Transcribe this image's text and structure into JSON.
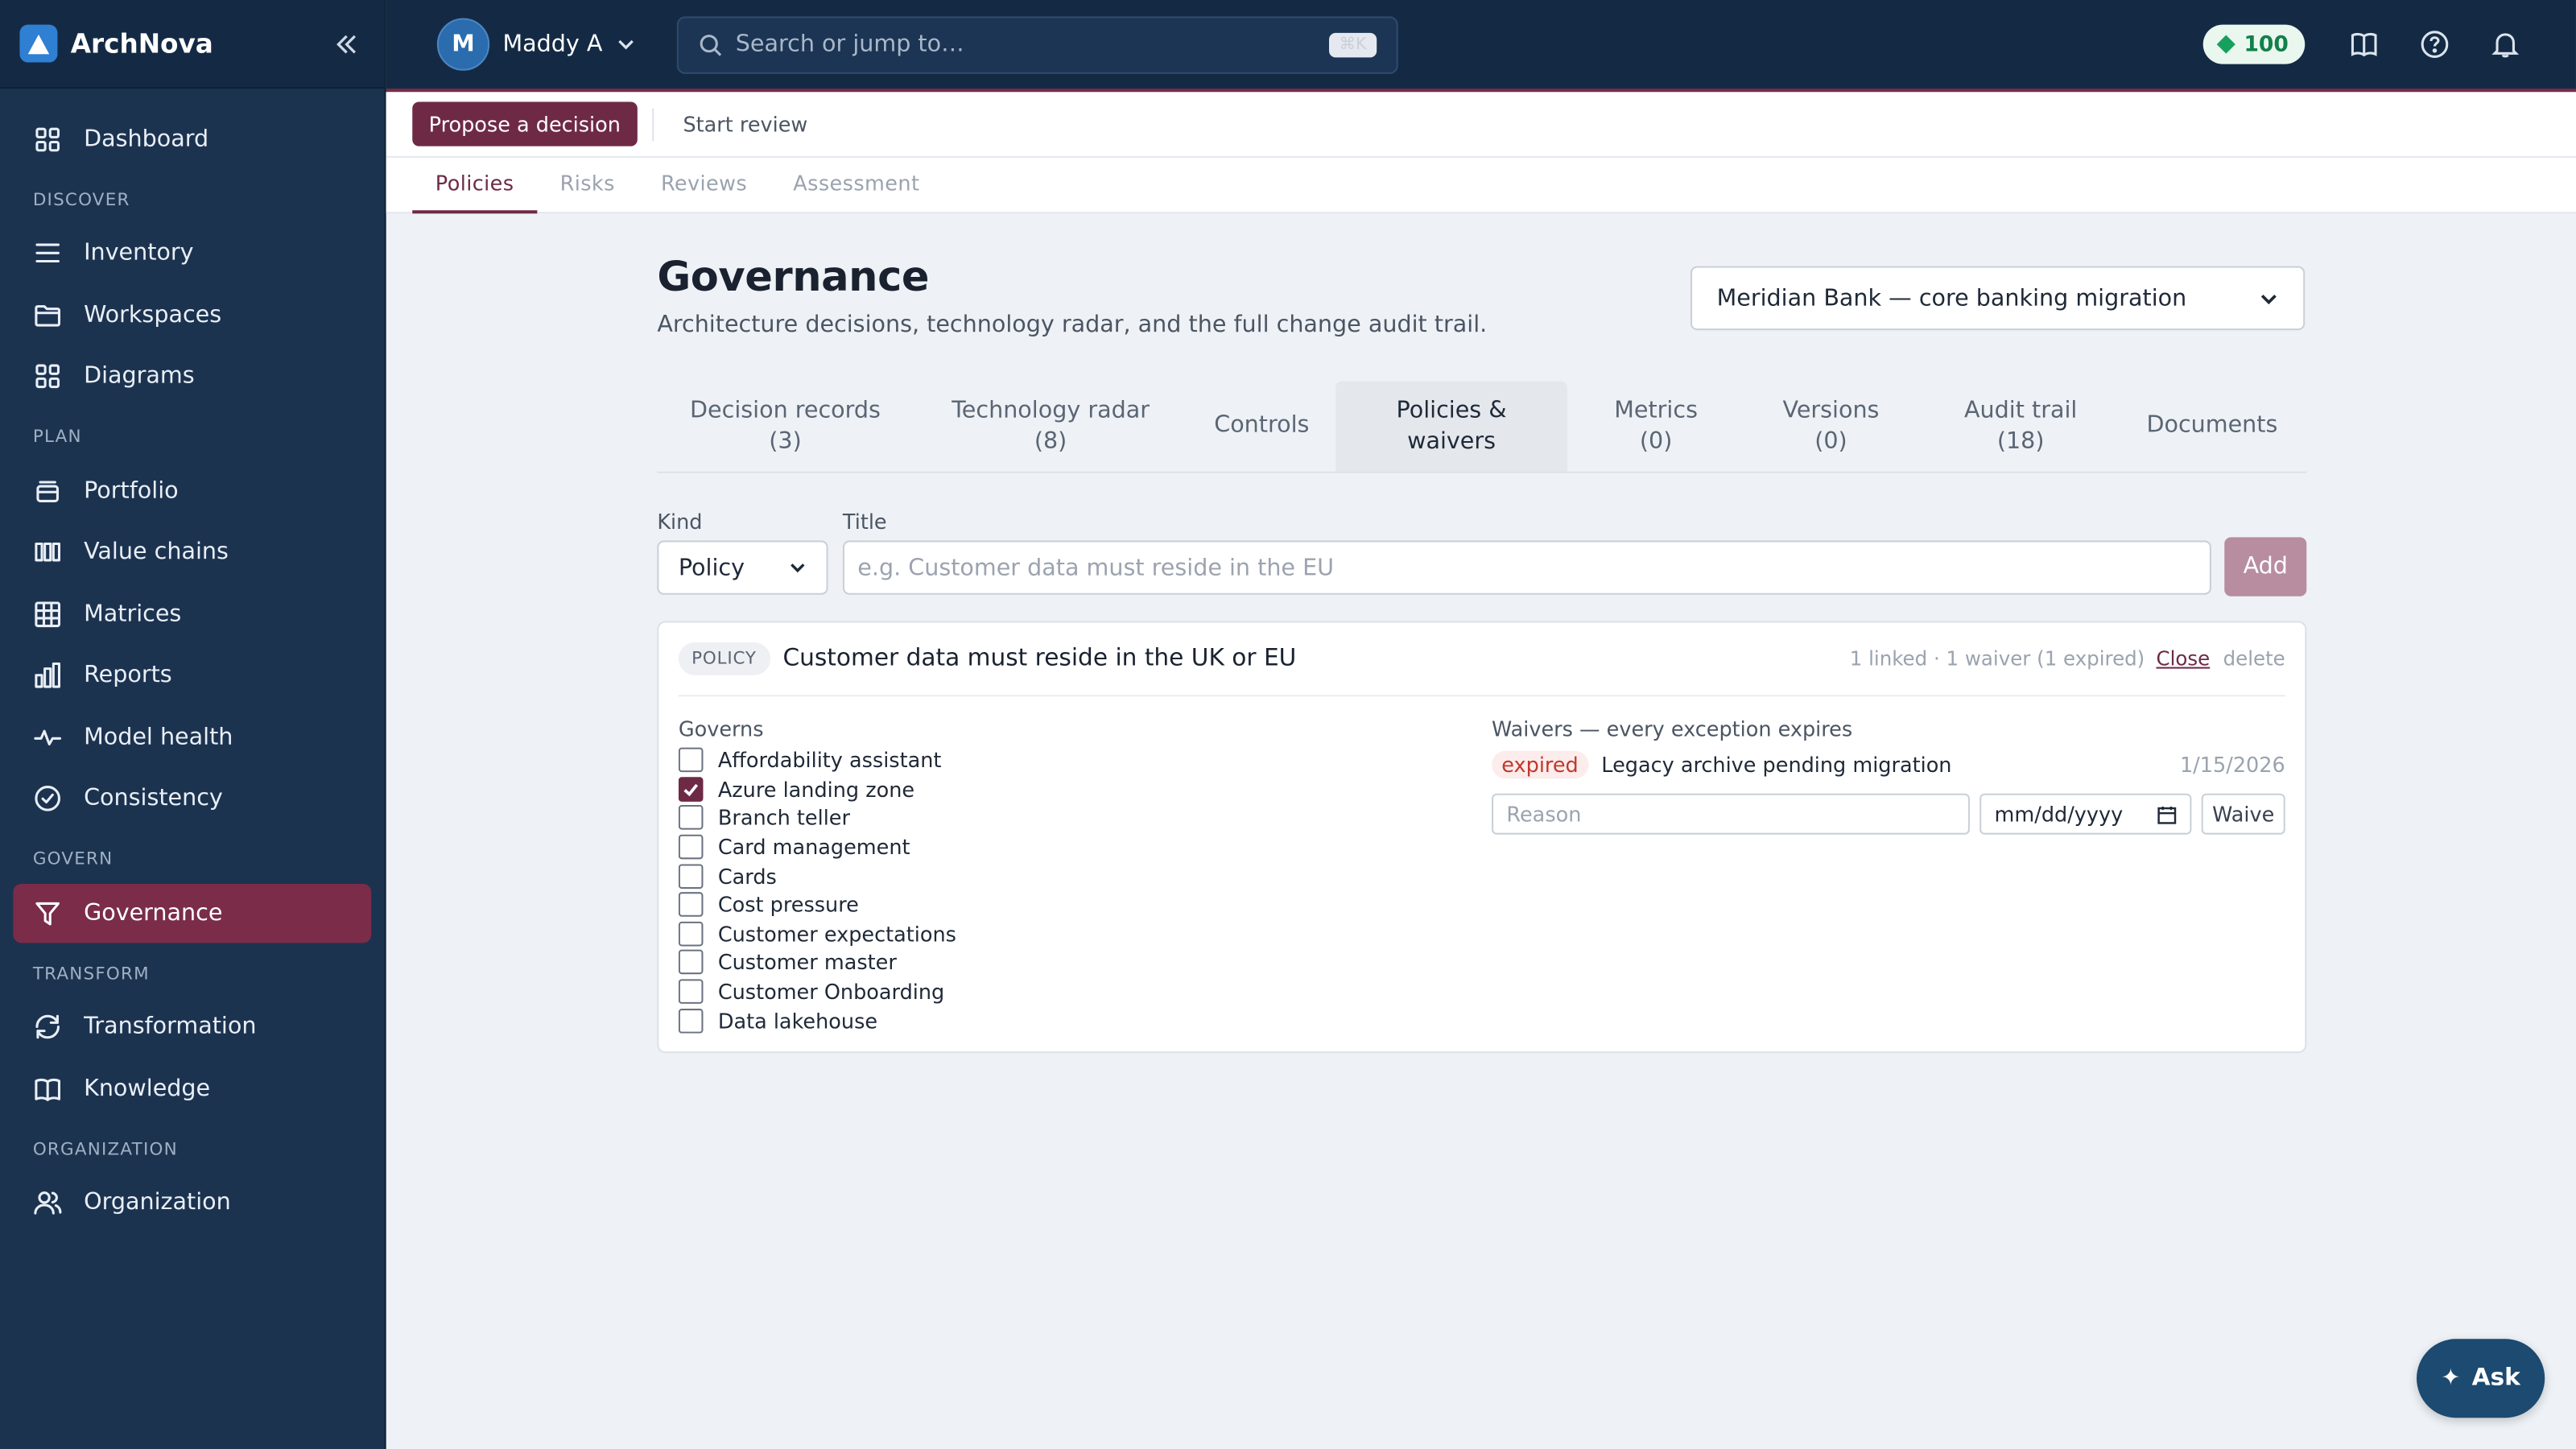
{
  "app": {
    "name": "ArchNova"
  },
  "user": {
    "initial": "M",
    "name": "Maddy A"
  },
  "search": {
    "placeholder": "Search or jump to…",
    "shortcut": "⌘K"
  },
  "credits": {
    "value": "100"
  },
  "sidebar": {
    "top_items": [
      {
        "label": "Dashboard",
        "icon": "grid-icon"
      }
    ],
    "sections": [
      {
        "title": "DISCOVER",
        "items": [
          {
            "label": "Inventory",
            "icon": "list-icon"
          },
          {
            "label": "Workspaces",
            "icon": "folder-icon"
          },
          {
            "label": "Diagrams",
            "icon": "grid-icon"
          }
        ]
      },
      {
        "title": "PLAN",
        "items": [
          {
            "label": "Portfolio",
            "icon": "stack-icon"
          },
          {
            "label": "Value chains",
            "icon": "columns-icon"
          },
          {
            "label": "Matrices",
            "icon": "table-icon"
          },
          {
            "label": "Reports",
            "icon": "bar-chart-icon"
          },
          {
            "label": "Model health",
            "icon": "pulse-icon"
          },
          {
            "label": "Consistency",
            "icon": "check-circle-icon"
          }
        ]
      },
      {
        "title": "GOVERN",
        "items": [
          {
            "label": "Governance",
            "icon": "filter-icon",
            "active": true
          }
        ]
      },
      {
        "title": "TRANSFORM",
        "items": [
          {
            "label": "Transformation",
            "icon": "refresh-icon"
          },
          {
            "label": "Knowledge",
            "icon": "book-icon"
          }
        ]
      },
      {
        "title": "ORGANIZATION",
        "items": [
          {
            "label": "Organization",
            "icon": "users-icon"
          }
        ]
      }
    ]
  },
  "actions": {
    "propose": "Propose a decision",
    "review": "Start review"
  },
  "subtabs": [
    {
      "label": "Policies",
      "active": true
    },
    {
      "label": "Risks"
    },
    {
      "label": "Reviews"
    },
    {
      "label": "Assessment"
    }
  ],
  "page": {
    "title": "Governance",
    "subtitle": "Architecture decisions, technology radar, and the full change audit trail.",
    "project": "Meridian Bank — core banking migration"
  },
  "governance_tabs": [
    {
      "line1": "Decision records",
      "line2": "(3)"
    },
    {
      "line1": "Technology radar",
      "line2": "(8)"
    },
    {
      "line1": "Controls",
      "line2": ""
    },
    {
      "line1": "Policies &",
      "line2": "waivers",
      "active": true
    },
    {
      "line1": "Metrics",
      "line2": "(0)"
    },
    {
      "line1": "Versions",
      "line2": "(0)"
    },
    {
      "line1": "Audit trail",
      "line2": "(18)"
    },
    {
      "line1": "Documents",
      "line2": ""
    }
  ],
  "form": {
    "kind_label": "Kind",
    "kind_value": "Policy",
    "title_label": "Title",
    "title_placeholder": "e.g. Customer data must reside in the EU",
    "add_label": "Add"
  },
  "policy": {
    "badge": "POLICY",
    "title": "Customer data must reside in the UK or EU",
    "meta": "1 linked · 1 waiver (1 expired)",
    "close_label": "Close",
    "delete_label": "delete",
    "governs_label": "Governs",
    "governs": [
      {
        "label": "Affordability assistant",
        "checked": false
      },
      {
        "label": "Azure landing zone",
        "checked": true
      },
      {
        "label": "Branch teller",
        "checked": false
      },
      {
        "label": "Card management",
        "checked": false
      },
      {
        "label": "Cards",
        "checked": false
      },
      {
        "label": "Cost pressure",
        "checked": false
      },
      {
        "label": "Customer expectations",
        "checked": false
      },
      {
        "label": "Customer master",
        "checked": false
      },
      {
        "label": "Customer Onboarding",
        "checked": false
      },
      {
        "label": "Data lakehouse",
        "checked": false
      }
    ],
    "waivers_label": "Waivers — every exception expires",
    "waivers": [
      {
        "status": "expired",
        "reason": "Legacy archive pending migration",
        "date": "1/15/2026"
      }
    ],
    "reason_placeholder": "Reason",
    "date_placeholder": "mm/dd/yyyy",
    "waive_label": "Waive"
  },
  "ask": {
    "label": "Ask"
  },
  "colors": {
    "brand": "#6e2a45",
    "sidebar": "#1c3350",
    "topbar": "#142a44"
  }
}
